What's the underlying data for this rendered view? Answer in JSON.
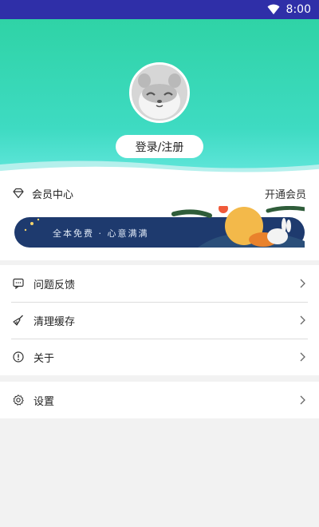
{
  "status": {
    "time": "8:00"
  },
  "profile": {
    "login_label": "登录/注册"
  },
  "vip": {
    "title": "会员中心",
    "open_label": "开通会员",
    "banner_text": "全本免费 · 心意满满"
  },
  "menu": [
    {
      "label": "问题反馈",
      "icon": "feedback-icon"
    },
    {
      "label": "清理缓存",
      "icon": "broom-icon"
    },
    {
      "label": "关于",
      "icon": "info-icon"
    }
  ],
  "settings": {
    "label": "设置",
    "icon": "gear-icon"
  },
  "colors": {
    "statusbar": "#2f2fa8",
    "header_top": "#2fd3a6",
    "header_bottom": "#62e6dc",
    "banner_bg": "#1e3a6e",
    "moon": "#f3b94a"
  }
}
